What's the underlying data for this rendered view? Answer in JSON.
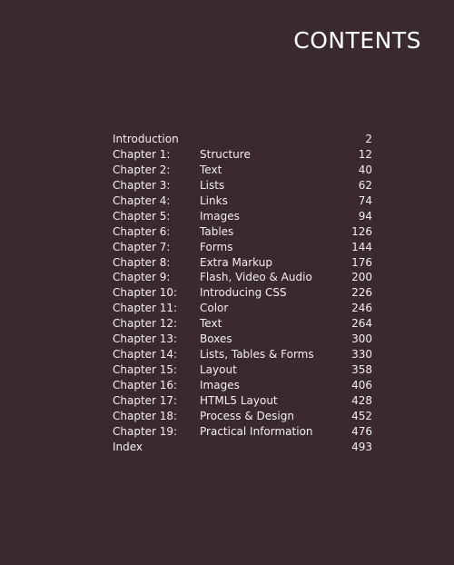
{
  "title": "CONTENTS",
  "entries": [
    {
      "label": "Introduction",
      "name": "",
      "page": "2"
    },
    {
      "label": "Chapter 1:",
      "name": "Structure",
      "page": "12"
    },
    {
      "label": "Chapter 2:",
      "name": "Text",
      "page": "40"
    },
    {
      "label": "Chapter 3:",
      "name": "Lists",
      "page": "62"
    },
    {
      "label": "Chapter 4:",
      "name": "Links",
      "page": "74"
    },
    {
      "label": "Chapter 5:",
      "name": "Images",
      "page": "94"
    },
    {
      "label": "Chapter 6:",
      "name": "Tables",
      "page": "126"
    },
    {
      "label": "Chapter 7:",
      "name": "Forms",
      "page": "144"
    },
    {
      "label": "Chapter 8:",
      "name": "Extra Markup",
      "page": "176"
    },
    {
      "label": "Chapter 9:",
      "name": "Flash, Video & Audio",
      "page": "200"
    },
    {
      "label": "Chapter 10:",
      "name": "Introducing CSS",
      "page": "226"
    },
    {
      "label": "Chapter 11:",
      "name": "Color",
      "page": "246"
    },
    {
      "label": "Chapter 12:",
      "name": "Text",
      "page": "264"
    },
    {
      "label": "Chapter 13:",
      "name": "Boxes",
      "page": "300"
    },
    {
      "label": "Chapter 14:",
      "name": "Lists, Tables & Forms",
      "page": "330"
    },
    {
      "label": "Chapter 15:",
      "name": "Layout",
      "page": "358"
    },
    {
      "label": "Chapter 16:",
      "name": "Images",
      "page": "406"
    },
    {
      "label": "Chapter 17:",
      "name": "HTML5 Layout",
      "page": "428"
    },
    {
      "label": "Chapter 18:",
      "name": "Process & Design",
      "page": "452"
    },
    {
      "label": "Chapter 19:",
      "name": "Practical Information",
      "page": "476"
    },
    {
      "label": "Index",
      "name": "",
      "page": "493"
    }
  ]
}
